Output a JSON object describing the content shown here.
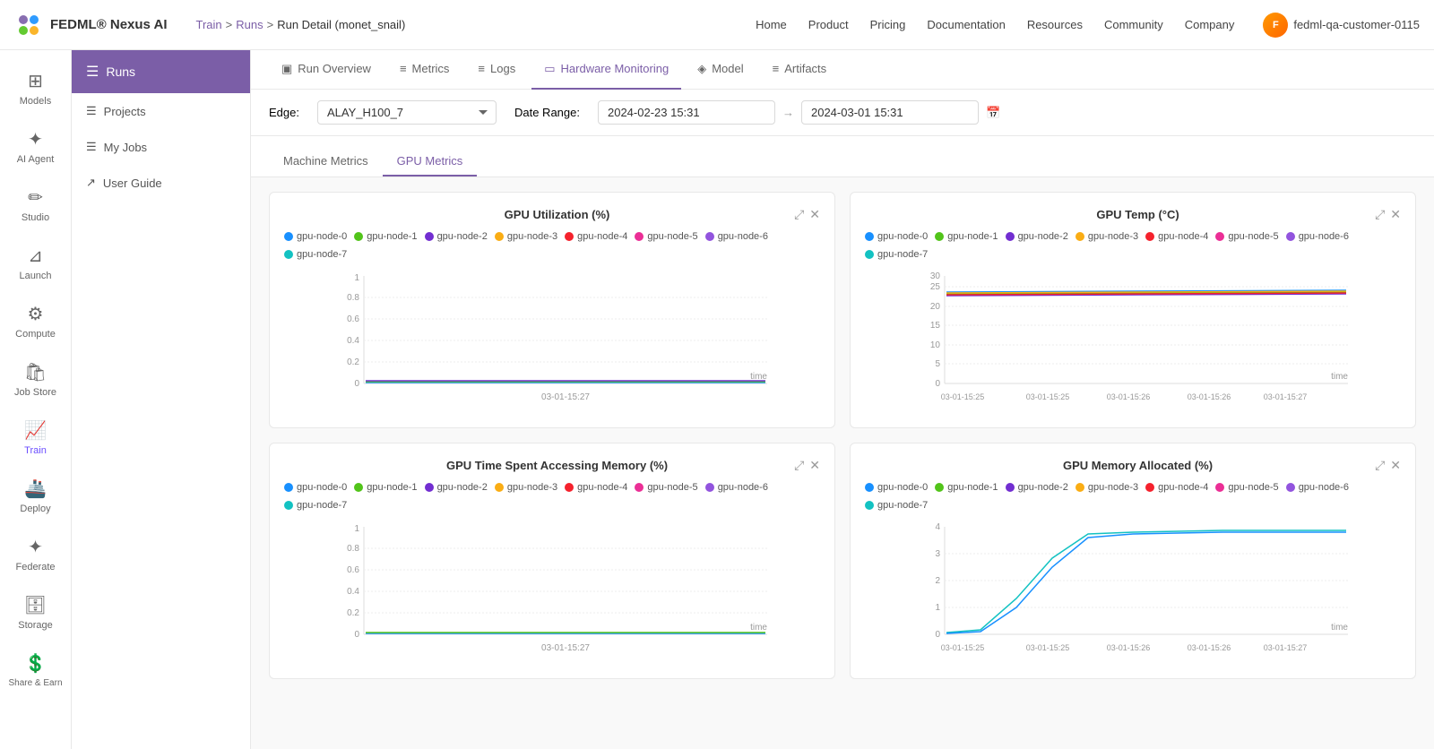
{
  "logo": {
    "text": "FEDML® Nexus AI"
  },
  "breadcrumb": {
    "items": [
      "Train",
      "Runs",
      "Run Detail (monet_snail)"
    ]
  },
  "top_nav": {
    "links": [
      "Home",
      "Product",
      "Pricing",
      "Documentation",
      "Resources",
      "Community",
      "Company"
    ]
  },
  "user": {
    "name": "fedml-qa-customer-0115",
    "initials": "F"
  },
  "sidebar": {
    "items": [
      {
        "id": "models",
        "label": "Models",
        "icon": "⊞"
      },
      {
        "id": "ai-agent",
        "label": "AI Agent",
        "icon": "❖"
      },
      {
        "id": "studio",
        "label": "Studio",
        "icon": "✏"
      },
      {
        "id": "launch",
        "label": "Launch",
        "icon": "🚀"
      },
      {
        "id": "compute",
        "label": "Compute",
        "icon": "⚙"
      },
      {
        "id": "job-store",
        "label": "Job Store",
        "icon": "🛍"
      },
      {
        "id": "train",
        "label": "Train",
        "icon": "📊"
      },
      {
        "id": "deploy",
        "label": "Deploy",
        "icon": "🚢"
      },
      {
        "id": "federate",
        "label": "Federate",
        "icon": "🔗"
      },
      {
        "id": "storage",
        "label": "Storage",
        "icon": "💾"
      },
      {
        "id": "share-earn",
        "label": "Share & Earn",
        "icon": "💰"
      }
    ]
  },
  "runs_sidebar": {
    "header": "Runs",
    "menu_items": [
      {
        "label": "Projects"
      },
      {
        "label": "My Jobs"
      },
      {
        "label": "User Guide"
      }
    ]
  },
  "tabs": [
    {
      "id": "run-overview",
      "label": "Run Overview",
      "icon": "▣"
    },
    {
      "id": "metrics",
      "label": "Metrics",
      "icon": "≡"
    },
    {
      "id": "logs",
      "label": "Logs",
      "icon": "≡"
    },
    {
      "id": "hardware-monitoring",
      "label": "Hardware Monitoring",
      "icon": "▭",
      "active": true
    },
    {
      "id": "model",
      "label": "Model",
      "icon": "◈"
    },
    {
      "id": "artifacts",
      "label": "Artifacts",
      "icon": "≡"
    }
  ],
  "filter": {
    "edge_label": "Edge:",
    "edge_value": "ALAY_H100_7",
    "date_range_label": "Date Range:",
    "date_from": "2024-02-23 15:31",
    "date_to": "2024-03-01 15:31"
  },
  "sub_tabs": [
    {
      "label": "Machine Metrics",
      "active": false
    },
    {
      "label": "GPU Metrics",
      "active": true
    }
  ],
  "gpu_nodes": [
    {
      "id": "gpu-node-0",
      "color": "#1890ff"
    },
    {
      "id": "gpu-node-1",
      "color": "#52c41a"
    },
    {
      "id": "gpu-node-2",
      "color": "#722ed1"
    },
    {
      "id": "gpu-node-3",
      "color": "#faad14"
    },
    {
      "id": "gpu-node-4",
      "color": "#f5222d"
    },
    {
      "id": "gpu-node-5",
      "color": "#eb2f96"
    },
    {
      "id": "gpu-node-6",
      "color": "#9254de"
    },
    {
      "id": "gpu-node-7",
      "color": "#13c2c2"
    }
  ],
  "charts": [
    {
      "id": "gpu-utilization",
      "title": "GPU Utilization (%)",
      "y_max": 1,
      "y_ticks": [
        "0",
        "0.2",
        "0.4",
        "0.6",
        "0.8"
      ],
      "x_label": "03-01-15:27",
      "x_ticks": [
        "03-01-15:27"
      ],
      "time_label": "time"
    },
    {
      "id": "gpu-temp",
      "title": "GPU Temp (°C)",
      "y_max": 30,
      "y_ticks": [
        "0",
        "5",
        "10",
        "15",
        "20",
        "25",
        "30"
      ],
      "x_label": "",
      "x_ticks": [
        "03-01-15:25",
        "03-01-15:25",
        "03-01-15:26",
        "03-01-15:26",
        "03-01-15:27",
        "03-01-15:27"
      ],
      "time_label": "time"
    },
    {
      "id": "gpu-memory-access",
      "title": "GPU Time Spent Accessing Memory (%)",
      "y_max": 1,
      "y_ticks": [
        "0",
        "0.2",
        "0.4",
        "0.6",
        "0.8"
      ],
      "x_label": "03-01-15:27",
      "x_ticks": [
        "03-01-15:27"
      ],
      "time_label": "time"
    },
    {
      "id": "gpu-memory-allocated",
      "title": "GPU Memory Allocated (%)",
      "y_max": 4,
      "y_ticks": [
        "0",
        "1",
        "2",
        "3",
        "4"
      ],
      "x_label": "",
      "x_ticks": [
        "03-01-15:25",
        "03-01-15:25",
        "03-01-15:26",
        "03-01-15:26",
        "03-01-15:27",
        "03-01-15:27"
      ],
      "time_label": "time"
    }
  ],
  "actions": {
    "expand": "⤢",
    "close": "✕"
  }
}
